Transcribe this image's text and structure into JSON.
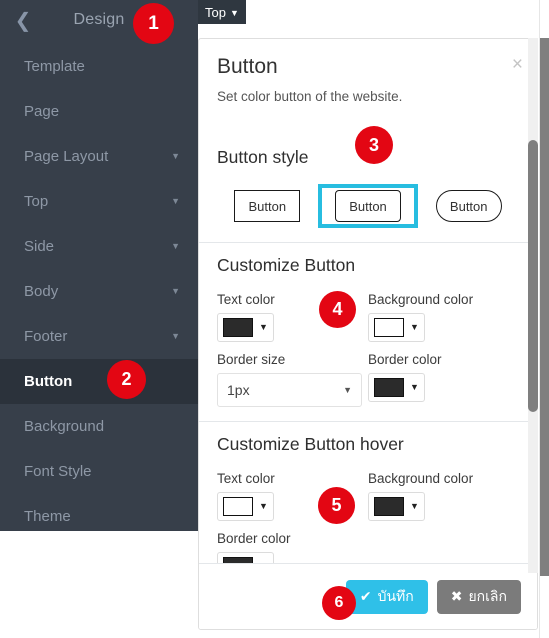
{
  "sidebar": {
    "title": "Design",
    "back_icon": "chevron-left-icon",
    "items": [
      {
        "label": "Template",
        "caret": false,
        "active": false
      },
      {
        "label": "Page",
        "caret": false,
        "active": false
      },
      {
        "label": "Page Layout",
        "caret": true,
        "active": false
      },
      {
        "label": "Top",
        "caret": true,
        "active": false
      },
      {
        "label": "Side",
        "caret": true,
        "active": false
      },
      {
        "label": "Body",
        "caret": true,
        "active": false
      },
      {
        "label": "Footer",
        "caret": true,
        "active": false
      },
      {
        "label": "Button",
        "caret": false,
        "active": true
      },
      {
        "label": "Background",
        "caret": false,
        "active": false
      },
      {
        "label": "Font Style",
        "caret": false,
        "active": false
      },
      {
        "label": "Theme",
        "caret": false,
        "active": false
      }
    ]
  },
  "top_tab": {
    "label": "Top",
    "caret": "▼"
  },
  "dialog": {
    "title": "Button",
    "subtitle": "Set color button of the website.",
    "close_label": "×",
    "button_style": {
      "heading": "Button style",
      "options": [
        {
          "label": "Button",
          "shape": "square",
          "selected": false
        },
        {
          "label": "Button",
          "shape": "rounded",
          "selected": true
        },
        {
          "label": "Button",
          "shape": "pill",
          "selected": false
        }
      ],
      "selection_color": "#27bde0"
    },
    "customize_button": {
      "heading": "Customize Button",
      "text_color": {
        "label": "Text color",
        "value": "#2b2b2b"
      },
      "background_color": {
        "label": "Background color",
        "value": "#ffffff"
      },
      "border_size": {
        "label": "Border size",
        "value": "1px"
      },
      "border_color": {
        "label": "Border color",
        "value": "#2b2b2b"
      }
    },
    "customize_button_hover": {
      "heading": "Customize Button hover",
      "text_color": {
        "label": "Text color",
        "value": "#ffffff"
      },
      "background_color": {
        "label": "Background color",
        "value": "#2b2b2b"
      },
      "border_color": {
        "label": "Border color",
        "value": "#2b2b2b"
      }
    },
    "footer": {
      "save_label": "บันทึก",
      "save_icon": "check-icon",
      "save_color": "#2fc0e8",
      "cancel_label": "ยกเลิก",
      "cancel_icon": "times-icon",
      "cancel_color": "#7b7b7b"
    }
  },
  "markers": {
    "m1": "1",
    "m2": "2",
    "m3": "3",
    "m4": "4",
    "m5": "5",
    "m6": "6",
    "color": "#e30613"
  }
}
